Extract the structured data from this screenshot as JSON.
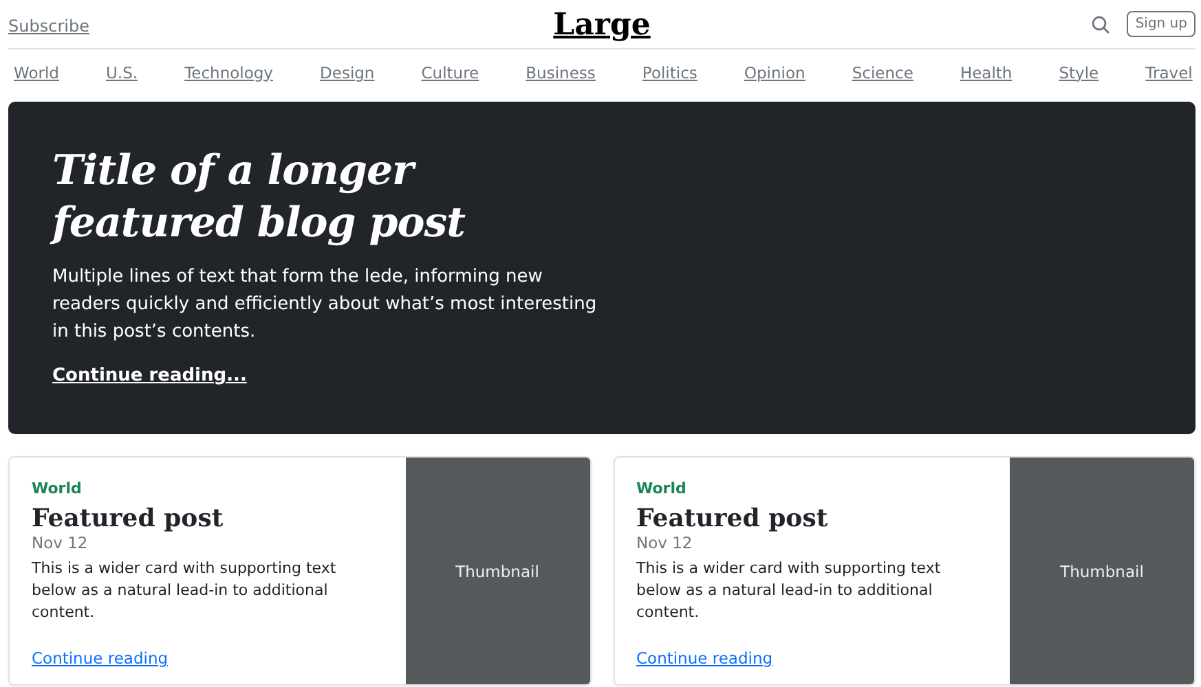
{
  "header": {
    "subscribe": "Subscribe",
    "logo": "Large",
    "signup": "Sign up"
  },
  "nav": [
    "World",
    "U.S.",
    "Technology",
    "Design",
    "Culture",
    "Business",
    "Politics",
    "Opinion",
    "Science",
    "Health",
    "Style",
    "Travel"
  ],
  "hero": {
    "title": "Title of a longer featured blog post",
    "lede": "Multiple lines of text that form the lede, informing new readers quickly and efficiently about what’s most interesting in this post’s contents.",
    "link": "Continue reading..."
  },
  "cards": [
    {
      "category": "World",
      "title": "Featured post",
      "date": "Nov 12",
      "text": "This is a wider card with supporting text below as a natural lead-in to additional content.",
      "link": "Continue reading",
      "thumbnail": "Thumbnail"
    },
    {
      "category": "World",
      "title": "Featured post",
      "date": "Nov 12",
      "text": "This is a wider card with supporting text below as a natural lead-in to additional content.",
      "link": "Continue reading",
      "thumbnail": "Thumbnail"
    }
  ]
}
